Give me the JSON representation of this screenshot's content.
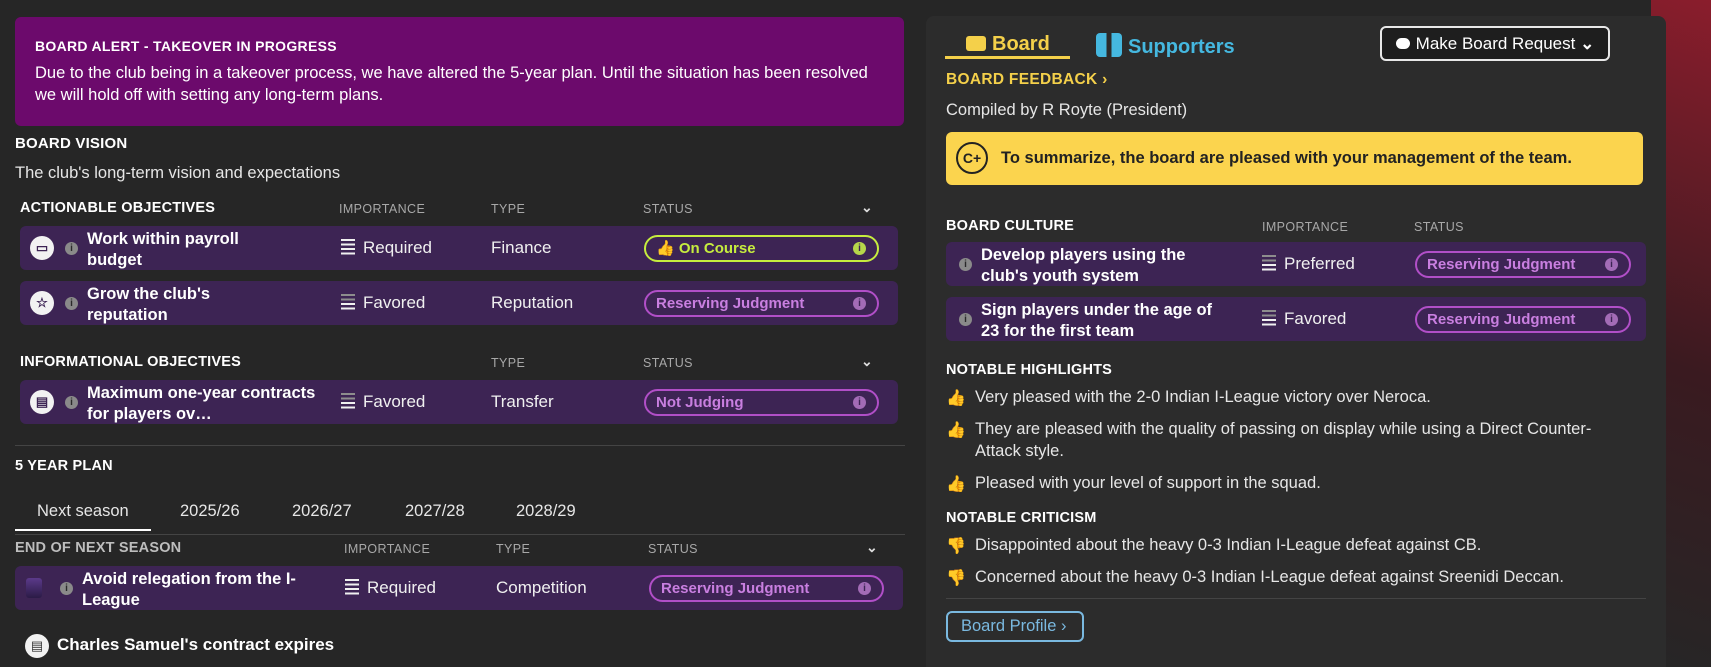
{
  "alert": {
    "title": "BOARD ALERT - TAKEOVER IN PROGRESS",
    "text": "Due to the club being in a takeover process, we have altered the 5-year plan. Until the situation has been resolved we will hold off with setting any long-term plans."
  },
  "vision": {
    "title": "BOARD VISION",
    "subtitle": "The club's long-term vision and expectations"
  },
  "actionable": {
    "header": "ACTIONABLE OBJECTIVES",
    "col_importance": "IMPORTANCE",
    "col_type": "TYPE",
    "col_status": "STATUS",
    "rows": [
      {
        "name": "Work within payroll budget",
        "importance": "Required",
        "type": "Finance",
        "status": "On Course",
        "icon": "money-icon"
      },
      {
        "name": "Grow the club's reputation",
        "importance": "Favored",
        "type": "Reputation",
        "status": "Reserving Judgment",
        "icon": "star-icon"
      }
    ]
  },
  "informational": {
    "header": "INFORMATIONAL OBJECTIVES",
    "col_type": "TYPE",
    "col_status": "STATUS",
    "rows": [
      {
        "name": "Maximum one-year contracts for players ov…",
        "importance": "Favored",
        "type": "Transfer",
        "status": "Not Judging",
        "icon": "document-icon"
      }
    ]
  },
  "plan": {
    "title": "5 YEAR PLAN",
    "tabs": [
      "Next season",
      "2025/26",
      "2026/27",
      "2027/28",
      "2028/29"
    ],
    "section_header": "END OF NEXT SEASON",
    "col_importance": "IMPORTANCE",
    "col_type": "TYPE",
    "col_status": "STATUS",
    "rows": [
      {
        "name": "Avoid relegation from the I-League",
        "importance": "Required",
        "type": "Competition",
        "status": "Reserving Judgment",
        "icon": "relegation-icon"
      }
    ],
    "contract_note": "Charles Samuel's contract expires"
  },
  "right": {
    "tab_board": "Board",
    "tab_supporters": "Supporters",
    "request_button": "Make Board Request",
    "feedback_link": "BOARD FEEDBACK",
    "compiled_by": "Compiled by R Royte (President)",
    "grade": "C+",
    "summary": "To summarize, the board are pleased with your management of the team.",
    "culture": {
      "header": "BOARD CULTURE",
      "col_importance": "IMPORTANCE",
      "col_status": "STATUS",
      "rows": [
        {
          "name": "Develop players using the club's youth system",
          "importance": "Preferred",
          "status": "Reserving Judgment"
        },
        {
          "name": "Sign players under the age of 23 for the first team",
          "importance": "Favored",
          "status": "Reserving Judgment"
        }
      ]
    },
    "highlights_header": "NOTABLE HIGHLIGHTS",
    "highlights": [
      "Very pleased with the 2-0 Indian I-League victory over Neroca.",
      "They are pleased with the quality of passing on display while using a Direct Counter-Attack style.",
      "Pleased with your level of support in the squad."
    ],
    "criticism_header": "NOTABLE CRITICISM",
    "criticism": [
      "Disappointed about the heavy 0-3 Indian I-League defeat against CB.",
      "Concerned about the heavy 0-3 Indian I-League defeat against Sreenidi Deccan."
    ],
    "profile_button": "Board Profile"
  },
  "colors": {
    "alert_bg": "#6c0a6c",
    "row_bg": "#3d2454",
    "status_purple": "#b14fc8",
    "status_green": "#c6ec3e",
    "board_accent": "#f4d04a",
    "supporters_accent": "#45b8e0",
    "summary_bg": "#fbd44e"
  }
}
